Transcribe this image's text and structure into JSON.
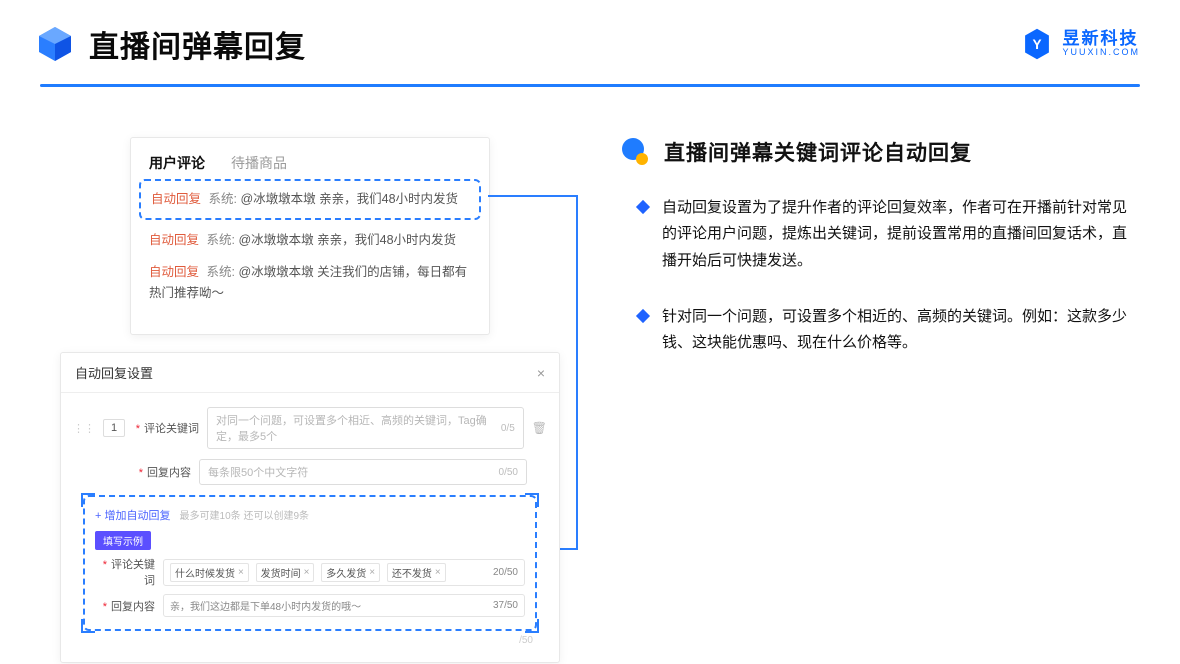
{
  "header": {
    "title": "直播间弹幕回复"
  },
  "brand": {
    "name": "昱新科技",
    "sub": "YUUXIN.COM"
  },
  "right": {
    "title": "直播间弹幕关键词评论自动回复",
    "bullets": [
      "自动回复设置为了提升作者的评论回复效率，作者可在开播前针对常见的评论用户问题，提炼出关键词，提前设置常用的直播间回复话术，直播开始后可快捷发送。",
      "针对同一个问题，可设置多个相近的、高频的关键词。例如：这款多少钱、这块能优惠吗、现在什么价格等。"
    ]
  },
  "comments": {
    "tab_active": "用户评论",
    "tab_other": "待播商品",
    "rows": [
      {
        "tag": "自动回复",
        "sys": "系统:",
        "text": "@冰墩墩本墩 亲亲，我们48小时内发货"
      },
      {
        "tag": "自动回复",
        "sys": "系统:",
        "text": "@冰墩墩本墩 亲亲，我们48小时内发货"
      },
      {
        "tag": "自动回复",
        "sys": "系统:",
        "text": "@冰墩墩本墩 关注我们的店铺，每日都有热门推荐呦～"
      }
    ]
  },
  "settings": {
    "title": "自动回复设置",
    "idx": "1",
    "kw_label": "评论关键词",
    "kw_placeholder": "对同一个问题，可设置多个相近、高频的关键词，Tag确定，最多5个",
    "kw_count": "0/5",
    "reply_label": "回复内容",
    "reply_placeholder": "每条限50个中文字符",
    "reply_count": "0/50",
    "add_text": "+ 增加自动回复",
    "add_hint": "最多可建10条 还可以创建9条",
    "example_badge": "填写示例",
    "ex_kw_label": "评论关键词",
    "ex_kw_chips": [
      "什么时候发货",
      "发货时间",
      "多久发货",
      "还不发货"
    ],
    "ex_kw_count": "20/50",
    "ex_reply_label": "回复内容",
    "ex_reply_text": "亲，我们这边都是下单48小时内发货的哦～",
    "ex_reply_count": "37/50",
    "outer_count": "/50"
  }
}
